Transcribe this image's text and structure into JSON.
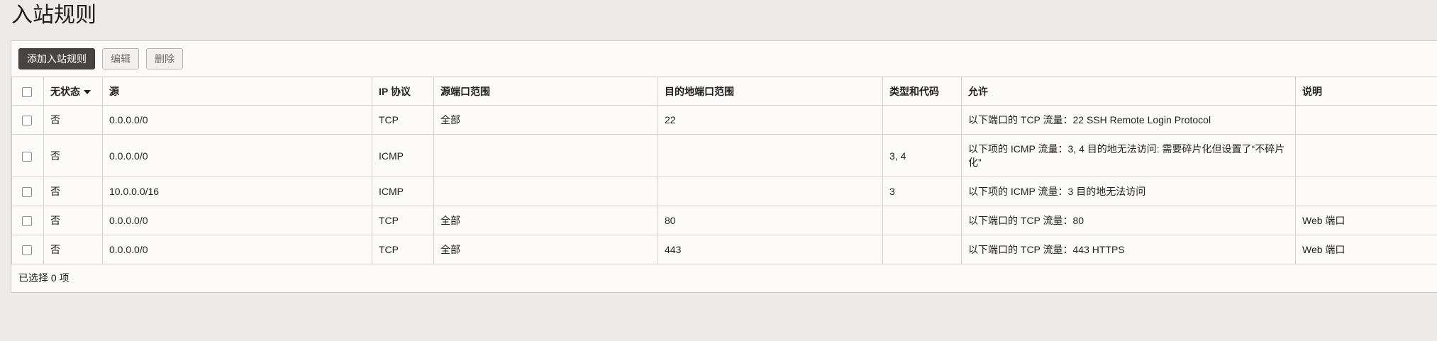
{
  "page": {
    "title": "入站规则"
  },
  "toolbar": {
    "add_label": "添加入站规则",
    "edit_label": "编辑",
    "delete_label": "删除"
  },
  "table": {
    "columns": [
      "无状态",
      "源",
      "IP 协议",
      "源端口范围",
      "目的地端口范围",
      "类型和代码",
      "允许",
      "说明"
    ],
    "sorted_column": "无状态",
    "sort_direction": "descending",
    "rows": [
      {
        "stateless": "否",
        "source": "0.0.0.0/0",
        "protocol": "TCP",
        "src_port": "全部",
        "dst_port": "22",
        "type_code": "",
        "allow": "以下端口的 TCP 流量：22 SSH Remote Login Protocol",
        "desc": ""
      },
      {
        "stateless": "否",
        "source": "0.0.0.0/0",
        "protocol": "ICMP",
        "src_port": "",
        "dst_port": "",
        "type_code": "3, 4",
        "allow": "以下项的 ICMP 流量：3, 4 目的地无法访问: 需要碎片化但设置了“不碎片化”",
        "desc": ""
      },
      {
        "stateless": "否",
        "source": "10.0.0.0/16",
        "protocol": "ICMP",
        "src_port": "",
        "dst_port": "",
        "type_code": "3",
        "allow": "以下项的 ICMP 流量：3 目的地无法访问",
        "desc": ""
      },
      {
        "stateless": "否",
        "source": "0.0.0.0/0",
        "protocol": "TCP",
        "src_port": "全部",
        "dst_port": "80",
        "type_code": "",
        "allow": "以下端口的 TCP 流量：80",
        "desc": "Web 端口"
      },
      {
        "stateless": "否",
        "source": "0.0.0.0/0",
        "protocol": "TCP",
        "src_port": "全部",
        "dst_port": "443",
        "type_code": "",
        "allow": "以下端口的 TCP 流量：443 HTTPS",
        "desc": "Web 端口"
      }
    ]
  },
  "footer": {
    "selected_text": "已选择 0 项"
  },
  "colors": {
    "primary_button": "#4a4441",
    "background": "#ecebe8",
    "panel": "#fcfbfa"
  }
}
